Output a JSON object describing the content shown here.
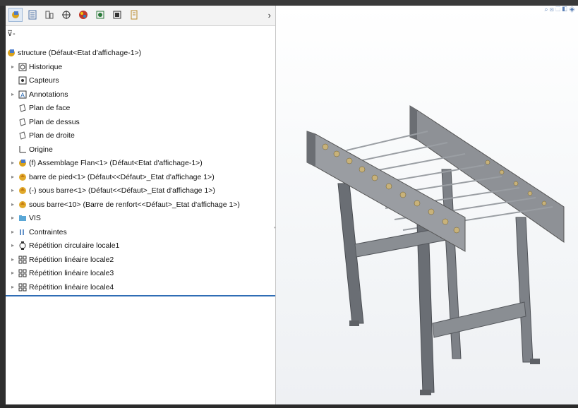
{
  "tabs": [
    {
      "icon": "feature-manager-icon",
      "active": true,
      "color": "#d9a21b"
    },
    {
      "icon": "property-manager-icon",
      "active": false,
      "color": "#4a6fa5"
    },
    {
      "icon": "configuration-manager-icon",
      "active": false,
      "color": "#555555"
    },
    {
      "icon": "dimxpert-icon",
      "active": false,
      "color": "#333333"
    },
    {
      "icon": "appearance-icon",
      "active": false,
      "color": "#c0392b"
    },
    {
      "icon": "camview-icon",
      "active": false,
      "color": "#2a7a3a"
    },
    {
      "icon": "display-manager-icon",
      "active": false,
      "color": "#333333"
    },
    {
      "icon": "cam-tree-icon",
      "active": false,
      "color": "#b88a2a"
    }
  ],
  "filter_symbol": "⊽-",
  "tree": [
    {
      "label": "structure  (Défaut<Etat d'affichage-1>)",
      "icon": "assembly-icon",
      "expandable": false,
      "level": 0
    },
    {
      "label": "Historique",
      "icon": "history-icon",
      "expandable": true,
      "level": 1
    },
    {
      "label": "Capteurs",
      "icon": "sensor-icon",
      "expandable": false,
      "level": 1
    },
    {
      "label": "Annotations",
      "icon": "annotation-icon",
      "expandable": true,
      "level": 1
    },
    {
      "label": "Plan de face",
      "icon": "plane-icon",
      "expandable": false,
      "level": 1
    },
    {
      "label": "Plan de dessus",
      "icon": "plane-icon",
      "expandable": false,
      "level": 1
    },
    {
      "label": "Plan de droite",
      "icon": "plane-icon",
      "expandable": false,
      "level": 1
    },
    {
      "label": "Origine",
      "icon": "origin-icon",
      "expandable": false,
      "level": 1
    },
    {
      "label": "(f) Assemblage Flan<1> (Défaut<Etat d'affichage-1>)",
      "icon": "subassembly-icon",
      "expandable": true,
      "level": 1
    },
    {
      "label": "barre de pied<1> (Défaut<<Défaut>_Etat d'affichage 1>)",
      "icon": "part-icon",
      "expandable": true,
      "level": 1
    },
    {
      "label": "(-) sous barre<1> (Défaut<<Défaut>_Etat d'affichage 1>)",
      "icon": "part-icon",
      "expandable": true,
      "level": 1
    },
    {
      "label": "sous barre<10> (Barre de renfort<<Défaut>_Etat d'affichage 1>)",
      "icon": "part-icon",
      "expandable": true,
      "level": 1
    },
    {
      "label": "VIS",
      "icon": "folder-icon",
      "expandable": true,
      "level": 1
    },
    {
      "label": "Contraintes",
      "icon": "mates-icon",
      "expandable": true,
      "level": 1
    },
    {
      "label": "Répétition circulaire locale1",
      "icon": "circular-pattern-icon",
      "expandable": true,
      "level": 1
    },
    {
      "label": "Répétition linéaire locale2",
      "icon": "linear-pattern-icon",
      "expandable": true,
      "level": 1
    },
    {
      "label": "Répétition linéaire locale3",
      "icon": "linear-pattern-icon",
      "expandable": true,
      "level": 1
    },
    {
      "label": "Répétition linéaire locale4",
      "icon": "linear-pattern-icon",
      "expandable": true,
      "level": 1
    }
  ],
  "colors": {
    "accent": "#2f6db5",
    "selection": "#dfe9f5"
  }
}
